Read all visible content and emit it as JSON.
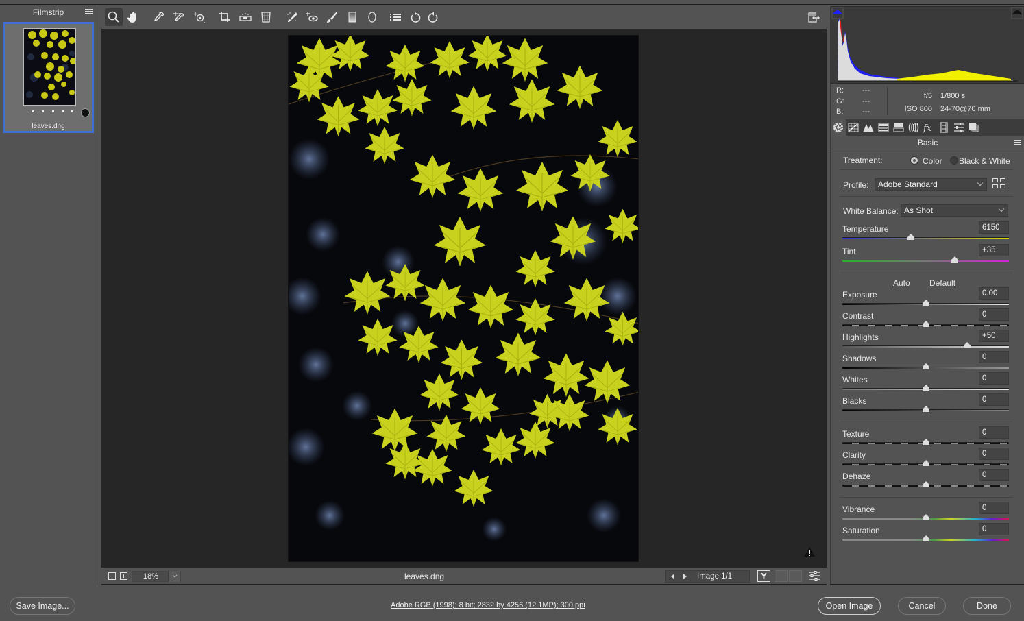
{
  "filmstrip": {
    "title": "Filmstrip",
    "items": [
      {
        "name": "leaves.dng",
        "rating_dots": 5,
        "selected": true
      }
    ]
  },
  "toolbar": {
    "tools": [
      {
        "name": "zoom-tool",
        "active": true
      },
      {
        "name": "hand-tool"
      },
      {
        "name": "white-balance-tool"
      },
      {
        "name": "color-sampler-tool"
      },
      {
        "name": "targeted-adjustment-tool"
      },
      {
        "name": "crop-tool"
      },
      {
        "name": "straighten-tool"
      },
      {
        "name": "transform-tool"
      },
      {
        "name": "spot-removal-tool"
      },
      {
        "name": "red-eye-removal-tool"
      },
      {
        "name": "adjustment-brush"
      },
      {
        "name": "graduated-filter"
      },
      {
        "name": "radial-filter"
      },
      {
        "name": "preferences"
      },
      {
        "name": "rotate-ccw"
      },
      {
        "name": "rotate-cw"
      }
    ],
    "fullscreen_toggle": "toggle-fullscreen"
  },
  "canvas": {
    "image_alt": "Yellow-green maple leaves backlit against a dark bokeh forest background",
    "zoom_level": "18%",
    "filename": "leaves.dng",
    "image_counter": "Image 1/1",
    "before_after_label": "Y"
  },
  "histogram": {
    "shadow_clip_color": "#0000ff",
    "highlight_clip_color": "#111111"
  },
  "info": {
    "rgb": [
      {
        "label": "R:",
        "value": "---"
      },
      {
        "label": "G:",
        "value": "---"
      },
      {
        "label": "B:",
        "value": "---"
      }
    ],
    "aperture": "f/5",
    "shutter": "1/800 s",
    "iso": "ISO 800",
    "lens": "24-70@70 mm"
  },
  "panel_tabs": [
    "basic",
    "tone-curve",
    "detail",
    "hsl",
    "split-toning",
    "lens-corrections",
    "effects",
    "camera-calibration",
    "presets",
    "snapshots"
  ],
  "basic": {
    "title": "Basic",
    "treatment_label": "Treatment:",
    "treatment_options": [
      "Color",
      "Black & White"
    ],
    "treatment_selected": "Color",
    "profile_label": "Profile:",
    "profile_value": "Adobe Standard",
    "wb_label": "White Balance:",
    "wb_value": "As Shot",
    "auto_label": "Auto",
    "default_label": "Default",
    "sliders": [
      {
        "key": "temperature",
        "label": "Temperature",
        "value": "6150",
        "pos": 0.41
      },
      {
        "key": "tint",
        "label": "Tint",
        "value": "+35",
        "pos": 0.675
      },
      {
        "key": "exposure",
        "label": "Exposure",
        "value": "0.00",
        "pos": 0.5
      },
      {
        "key": "contrast",
        "label": "Contrast",
        "value": "0",
        "pos": 0.5
      },
      {
        "key": "highlights",
        "label": "Highlights",
        "value": "+50",
        "pos": 0.75
      },
      {
        "key": "shadows",
        "label": "Shadows",
        "value": "0",
        "pos": 0.5
      },
      {
        "key": "whites",
        "label": "Whites",
        "value": "0",
        "pos": 0.5
      },
      {
        "key": "blacks",
        "label": "Blacks",
        "value": "0",
        "pos": 0.5
      },
      {
        "key": "texture",
        "label": "Texture",
        "value": "0",
        "pos": 0.5
      },
      {
        "key": "clarity",
        "label": "Clarity",
        "value": "0",
        "pos": 0.5
      },
      {
        "key": "dehaze",
        "label": "Dehaze",
        "value": "0",
        "pos": 0.5
      },
      {
        "key": "vibrance",
        "label": "Vibrance",
        "value": "0",
        "pos": 0.5
      },
      {
        "key": "saturation",
        "label": "Saturation",
        "value": "0",
        "pos": 0.5
      }
    ]
  },
  "footer": {
    "save_label": "Save Image...",
    "workflow_label": "Adobe RGB (1998); 8 bit; 2832 by 4256 (12.1MP); 300 ppi",
    "open_label": "Open Image",
    "cancel_label": "Cancel",
    "done_label": "Done"
  }
}
